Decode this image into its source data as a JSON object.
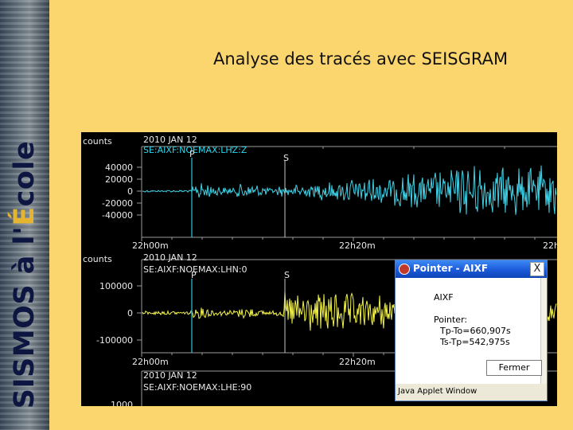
{
  "slide": {
    "title": "Analyse des tracés avec SEISGRAM",
    "banner_title": "SISMOS à l'",
    "banner_accent_letter": "É",
    "banner_title_end": "cole",
    "background_color": "#fbd56d"
  },
  "seismogram": {
    "traces": [
      {
        "units": "counts",
        "date": "2010 JAN 12",
        "station": "SE:AIXF:NOEMAX:LHZ:Z",
        "phase_P": "P",
        "phase_S": "S",
        "y_ticks": [
          "40000",
          "20000",
          "0",
          "-20000",
          "-40000"
        ],
        "x_ticks": [
          "22h00m",
          "22h20m",
          "22h"
        ],
        "color": "#3fd3e8"
      },
      {
        "units": "counts",
        "date": "2010 JAN 12",
        "station": "SE:AIXF:NOEMAX:LHN:0",
        "phase_P": "P",
        "phase_S": "S",
        "y_ticks": [
          "100000",
          "0",
          "-100000"
        ],
        "x_ticks": [
          "22h00m",
          "22h20m"
        ],
        "color": "#f2f24a"
      },
      {
        "units": "",
        "date": "2010 JAN 12",
        "station": "SE:AIXF:NOEMAX:LHE:90",
        "phase_P": "",
        "phase_S": "",
        "y_ticks": [
          "1000"
        ],
        "x_ticks": [],
        "color": "#d8d8ff"
      }
    ]
  },
  "pointer_window": {
    "title": "Pointer - AIXF",
    "close_label": "X",
    "station": "AIXF",
    "pointer_label": "Pointer:",
    "tp_to": "Tp-To=660,907s",
    "ts_tp": "Ts-Tp=542,975s",
    "button_label": "Fermer",
    "status": "Java Applet Window"
  }
}
